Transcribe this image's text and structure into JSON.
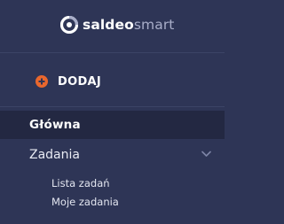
{
  "brand": {
    "name_bold": "saldeo",
    "name_light": "smart",
    "logo_icon": "saldeo-logo-icon"
  },
  "actions": {
    "add_label": "DODAJ",
    "add_icon": "plus-circle-icon",
    "add_icon_color": "#e9672d"
  },
  "nav": {
    "main_label": "Główna",
    "tasks": {
      "label": "Zadania",
      "expand_icon": "chevron-down-icon",
      "children": [
        {
          "label": "Lista zadań"
        },
        {
          "label": "Moje zadania"
        }
      ]
    }
  },
  "colors": {
    "sidebar_bg": "#2e3556",
    "active_bg": "#232842",
    "accent": "#e9672d"
  }
}
